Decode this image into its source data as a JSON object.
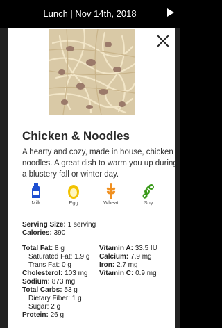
{
  "header": {
    "title": "Lunch | Nov 14th, 2018"
  },
  "dish": {
    "name": "Chicken & Noodles",
    "description": "A hearty and cozy, made in house, chicken & noodles. A great dish to warm you up during a blustery fall or winter day."
  },
  "allergens": [
    {
      "label": "Milk",
      "icon": "milk-icon",
      "color": "#1e4fd1"
    },
    {
      "label": "Egg",
      "icon": "egg-icon",
      "color": "#f2c200"
    },
    {
      "label": "Wheat",
      "icon": "wheat-icon",
      "color": "#f09020"
    },
    {
      "label": "Soy",
      "icon": "soy-icon",
      "color": "#3a9a1a"
    }
  ],
  "nutrition": {
    "serving_size_label": "Serving Size:",
    "serving_size_value": "1 serving",
    "calories_label": "Calories:",
    "calories_value": "390",
    "total_fat_label": "Total Fat:",
    "total_fat_value": "8 g",
    "sat_fat_label": "Saturated Fat:",
    "sat_fat_value": "1.9 g",
    "trans_fat_label": "Trans Fat:",
    "trans_fat_value": "0 g",
    "cholesterol_label": "Cholesterol:",
    "cholesterol_value": "103 mg",
    "sodium_label": "Sodium:",
    "sodium_value": "873 mg",
    "total_carbs_label": "Total Carbs:",
    "total_carbs_value": "53 g",
    "fiber_label": "Dietary Fiber:",
    "fiber_value": "1 g",
    "sugar_label": "Sugar:",
    "sugar_value": "2 g",
    "protein_label": "Protein:",
    "protein_value": "26 g",
    "vit_a_label": "Vitamin A:",
    "vit_a_value": "33.5 IU",
    "calcium_label": "Calcium:",
    "calcium_value": "7.9 mg",
    "iron_label": "Iron:",
    "iron_value": "2.7 mg",
    "vit_c_label": "Vitamin C:",
    "vit_c_value": "0.9 mg"
  }
}
